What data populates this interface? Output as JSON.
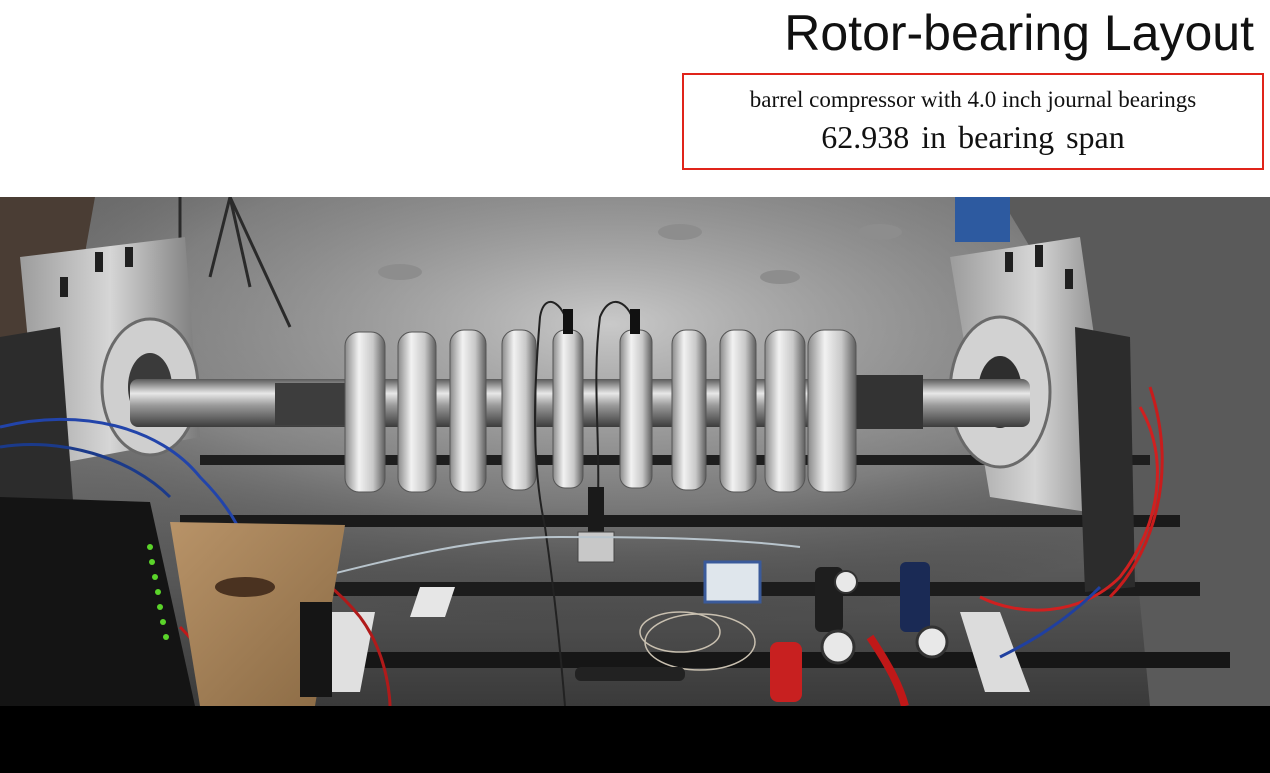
{
  "slide": {
    "title": "Rotor-bearing Layout",
    "spec_line1": "barrel compressor with 4.0 inch journal bearings",
    "spec_line2": "62.938 in bearing span"
  },
  "colors": {
    "highlight_border": "#e0241a",
    "background": "#ffffff",
    "bottom_bar": "#000000"
  }
}
